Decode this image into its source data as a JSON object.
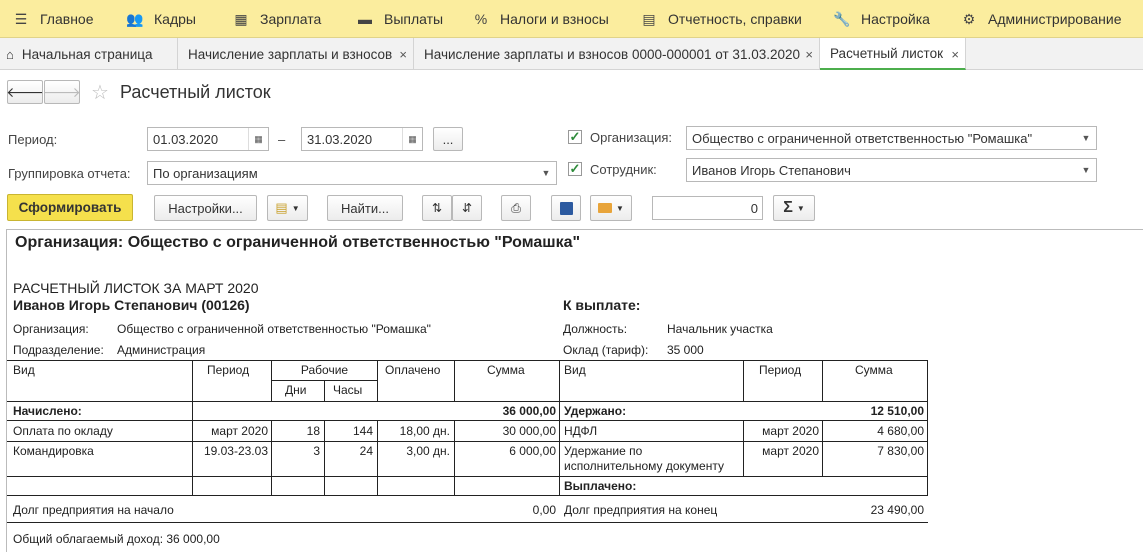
{
  "menu": {
    "items": [
      {
        "icon": "hamburger-icon",
        "glyph": "☰",
        "label": "Главное"
      },
      {
        "icon": "people-icon",
        "glyph": "👥",
        "label": "Кадры"
      },
      {
        "icon": "calculator-icon",
        "glyph": "▦",
        "label": "Зарплата"
      },
      {
        "icon": "money-icon",
        "glyph": "▬",
        "label": "Выплаты"
      },
      {
        "icon": "percent-icon",
        "glyph": "%",
        "label": "Налоги и взносы"
      },
      {
        "icon": "report-icon",
        "glyph": "▤",
        "label": "Отчетность, справки"
      },
      {
        "icon": "wrench-icon",
        "glyph": "🔧",
        "label": "Настройка"
      },
      {
        "icon": "gear-icon",
        "glyph": "⚙",
        "label": "Администрирование"
      }
    ]
  },
  "tabs": [
    {
      "label": "Начальная страница",
      "home": true
    },
    {
      "label": "Начисление зарплаты и взносов",
      "close": "×"
    },
    {
      "label": "Начисление зарплаты и взносов 0000-000001 от 31.03.2020",
      "close": "×"
    },
    {
      "label": "Расчетный листок",
      "close": "×",
      "active": true
    }
  ],
  "header": {
    "title": "Расчетный листок",
    "back": "🡐",
    "forward": "🡒",
    "star": "☆"
  },
  "form": {
    "period_label": "Период:",
    "date_from": "01.03.2020",
    "dash": "–",
    "date_to": "31.03.2020",
    "dots": "...",
    "grouping_label": "Группировка отчета:",
    "grouping_value": "По организациям",
    "org_label": "Организация:",
    "org_value": "Общество с ограниченной ответственностью \"Ромашка\"",
    "emp_label": "Сотрудник:",
    "emp_value": "Иванов Игорь Степанович",
    "check": "✓"
  },
  "toolbar": {
    "generate": "Сформировать",
    "settings": "Настройки...",
    "find": "Найти...",
    "sum_value": "0",
    "sigma": "Σ"
  },
  "report": {
    "org_heading": "Организация: Общество с ограниченной ответственностью \"Ромашка\"",
    "title": "РАСЧЕТНЫЙ ЛИСТОК ЗА МАРТ 2020",
    "employee": "Иванов Игорь Степанович (00126)",
    "to_pay": "К выплате:",
    "org_label": "Организация:",
    "org_value": "Общество с ограниченной ответственностью \"Ромашка\"",
    "dept_label": "Подразделение:",
    "dept_value": "Администрация",
    "position_label": "Должность:",
    "position_value": "Начальник участка",
    "salary_label": "Оклад (тариф):",
    "salary_value": "35 000",
    "cols_left": {
      "kind": "Вид",
      "period": "Период",
      "work": "Рабочие",
      "days": "Дни",
      "hours": "Часы",
      "paid": "Оплачено",
      "sum": "Сумма"
    },
    "cols_right": {
      "kind": "Вид",
      "period": "Период",
      "sum": "Сумма"
    },
    "accrued_label": "Начислено:",
    "accrued_total": "36 000,00",
    "withheld_label": "Удержано:",
    "withheld_total": "12 510,00",
    "accruals": [
      {
        "kind": "Оплата по окладу",
        "period": "март 2020",
        "days": "18",
        "hours": "144",
        "paid": "18,00 дн.",
        "sum": "30 000,00"
      },
      {
        "kind": "Командировка",
        "period": "19.03-23.03",
        "days": "3",
        "hours": "24",
        "paid": "3,00 дн.",
        "sum": "6 000,00"
      }
    ],
    "deductions": [
      {
        "kind": "НДФЛ",
        "period": "март 2020",
        "sum": "4 680,00"
      },
      {
        "kind": "Удержание по",
        "kind2": "исполнительному документу",
        "period": "март 2020",
        "sum": "7 830,00"
      }
    ],
    "paid_label": "Выплачено:",
    "debt_start_label": "Долг предприятия на начало",
    "debt_start_value": "0,00",
    "debt_end_label": "Долг предприятия на конец",
    "debt_end_value": "23 490,00",
    "taxable": "Общий облагаемый доход: 36 000,00"
  }
}
